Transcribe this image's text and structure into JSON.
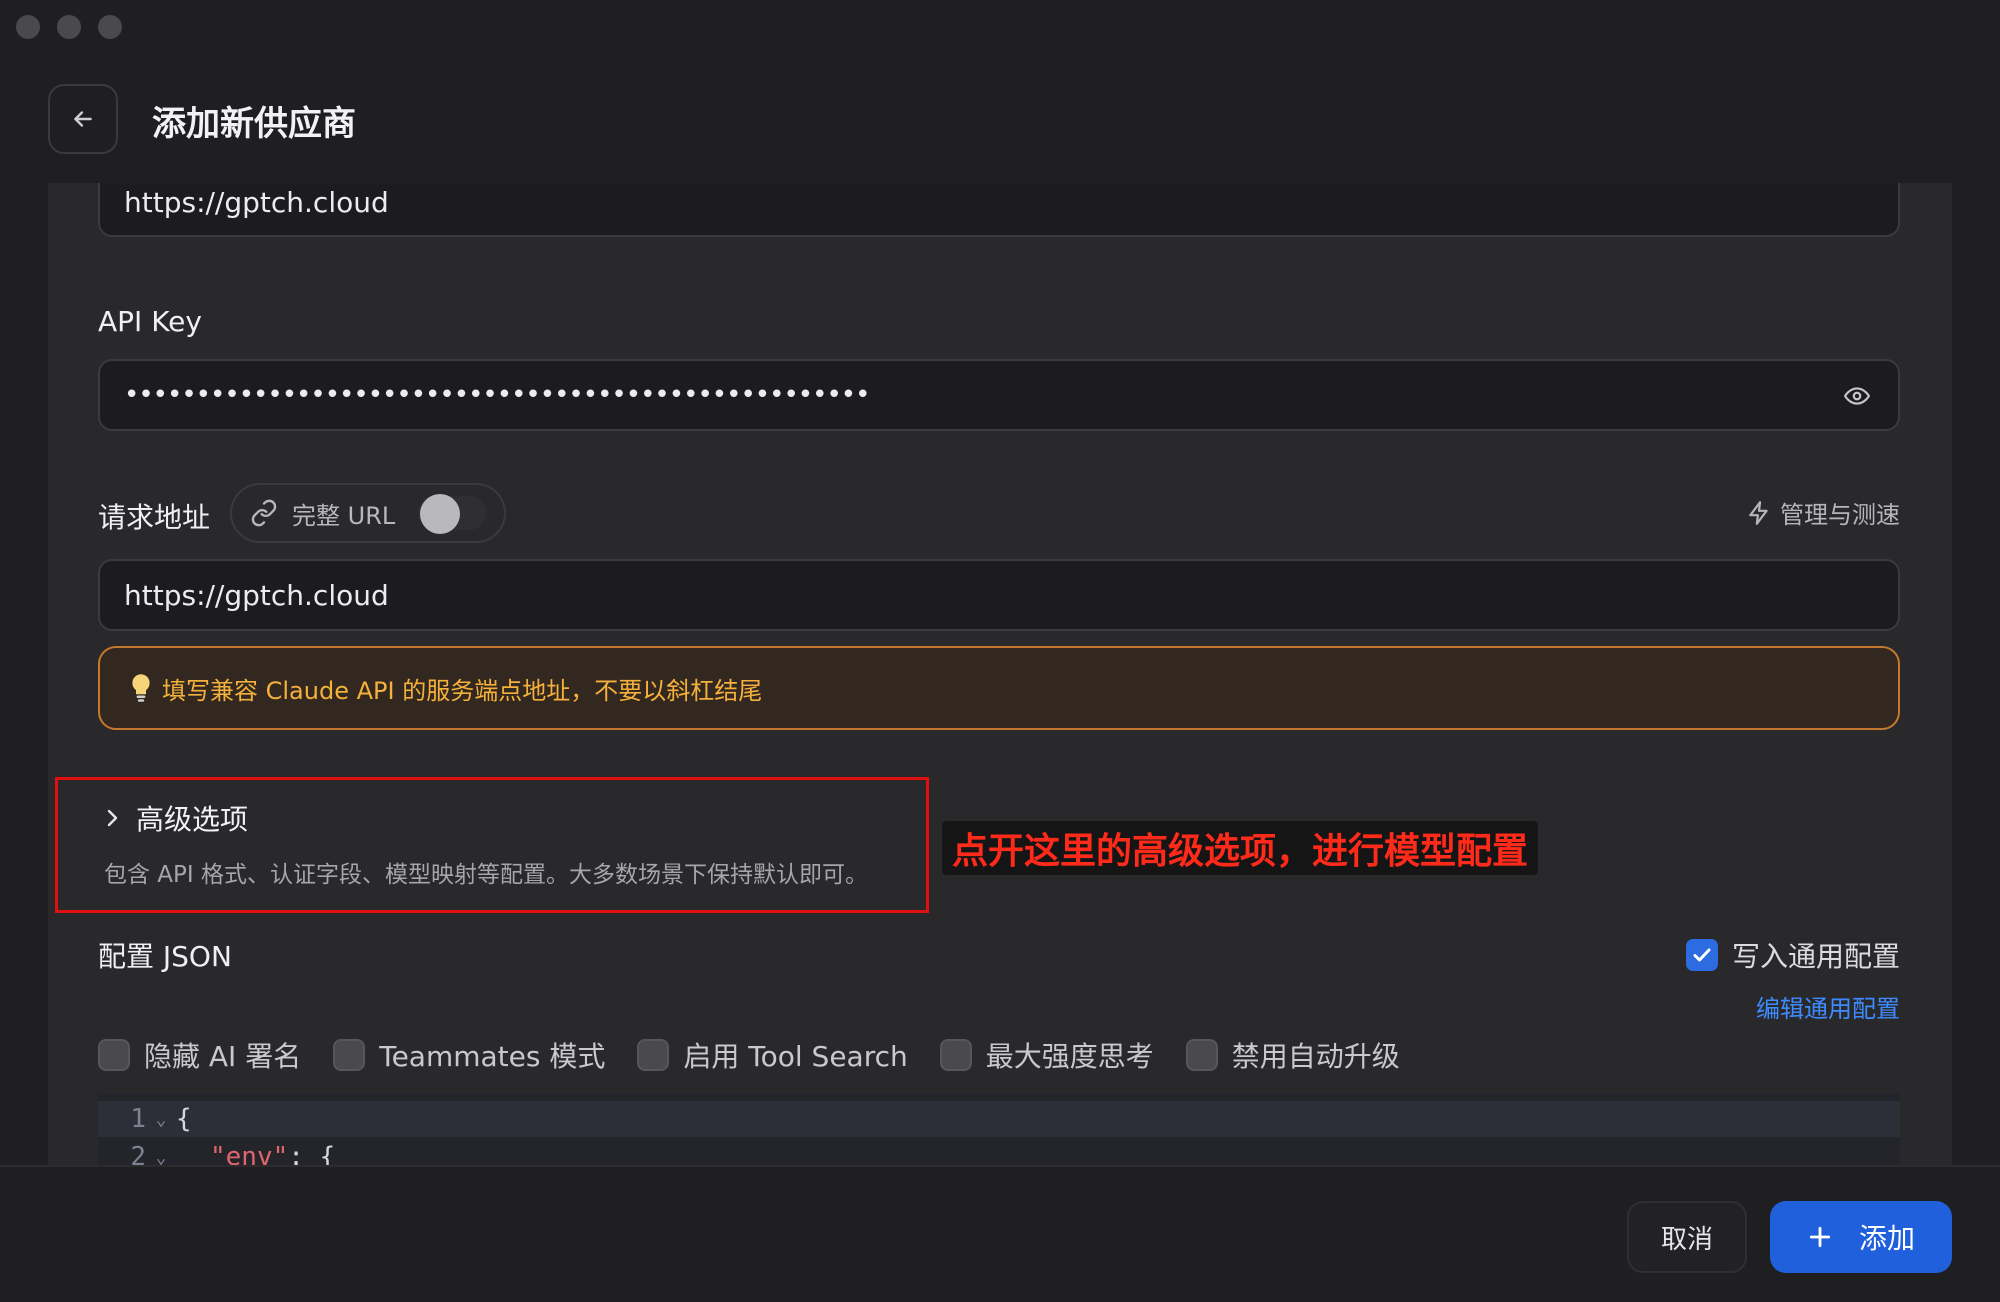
{
  "header": {
    "title": "添加新供应商"
  },
  "form": {
    "website_value": "https://gptch.cloud",
    "api_key_label": "API Key",
    "api_key_value": "••••••••••••••••••••••••••••••••••••••••••••••••••••",
    "request_url_label": "请求地址",
    "full_url_toggle_label": "完整 URL",
    "full_url_toggle_on": false,
    "manage_speedtest_label": "管理与测速",
    "request_url_value": "https://gptch.cloud",
    "hint_text": "填写兼容 Claude API 的服务端点地址，不要以斜杠结尾"
  },
  "advanced": {
    "title": "高级选项",
    "description": "包含 API 格式、认证字段、模型映射等配置。大多数场景下保持默认即可。"
  },
  "annotation": {
    "text": "点开这里的高级选项，进行模型配置",
    "color": "#ff2a1a",
    "highlight_color": "#e01010"
  },
  "config": {
    "title": "配置 JSON",
    "write_common_label": "写入通用配置",
    "write_common_checked": true,
    "edit_common_link": "编辑通用配置",
    "options": [
      {
        "label": "隐藏 AI 署名",
        "checked": false
      },
      {
        "label": "Teammates 模式",
        "checked": false
      },
      {
        "label": "启用 Tool Search",
        "checked": false
      },
      {
        "label": "最大强度思考",
        "checked": false
      },
      {
        "label": "禁用自动升级",
        "checked": false
      }
    ],
    "code_lines": [
      {
        "num": "1",
        "text": "{"
      },
      {
        "num": "2",
        "key": "\"env\"",
        "rest": ": {"
      }
    ]
  },
  "footer": {
    "cancel_label": "取消",
    "add_label": "添加"
  },
  "colors": {
    "accent": "#2160dc",
    "link": "#3d8bff",
    "hint_text": "#f5b13b",
    "hint_border": "#c4782e"
  }
}
